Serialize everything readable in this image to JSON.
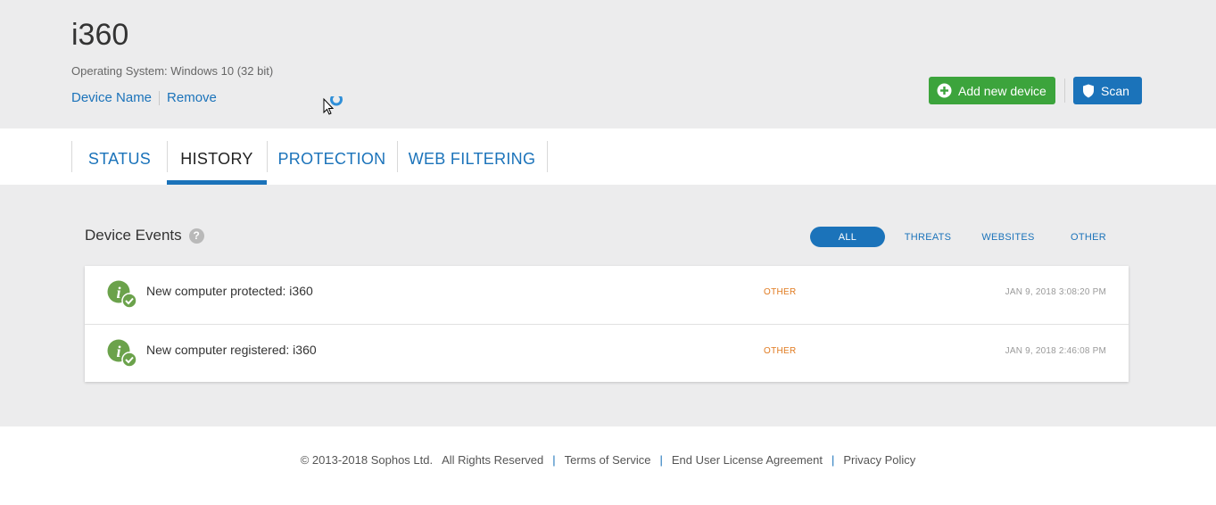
{
  "device": {
    "name": "i360",
    "os_label": "Operating System: Windows 10 (32 bit)",
    "links": {
      "device_name": "Device Name",
      "remove": "Remove"
    }
  },
  "actions": {
    "add_device": "Add new device",
    "scan": "Scan"
  },
  "tabs": [
    {
      "label": "STATUS",
      "active": false
    },
    {
      "label": "HISTORY",
      "active": true
    },
    {
      "label": "PROTECTION",
      "active": false
    },
    {
      "label": "WEB FILTERING",
      "active": false
    }
  ],
  "events": {
    "title": "Device Events",
    "help": "?",
    "filters": [
      {
        "label": "ALL",
        "active": true
      },
      {
        "label": "THREATS",
        "active": false
      },
      {
        "label": "WEBSITES",
        "active": false
      },
      {
        "label": "OTHER",
        "active": false
      }
    ],
    "items": [
      {
        "icon": "info-check-icon",
        "text": "New computer protected: i360",
        "category": "OTHER",
        "time": "JAN 9, 2018 3:08:20 PM"
      },
      {
        "icon": "info-check-icon",
        "text": "New computer registered: i360",
        "category": "OTHER",
        "time": "JAN 9, 2018 2:46:08 PM"
      }
    ]
  },
  "footer": {
    "copyright": "© 2013-2018 Sophos Ltd.",
    "rights": "All Rights Reserved",
    "sep": "|",
    "links": [
      "Terms of Service",
      "End User License Agreement",
      "Privacy Policy"
    ]
  },
  "colors": {
    "primary_blue": "#1b73ba",
    "green": "#3ca43c",
    "header_bg": "#ececed",
    "category_orange": "#e07a20"
  }
}
